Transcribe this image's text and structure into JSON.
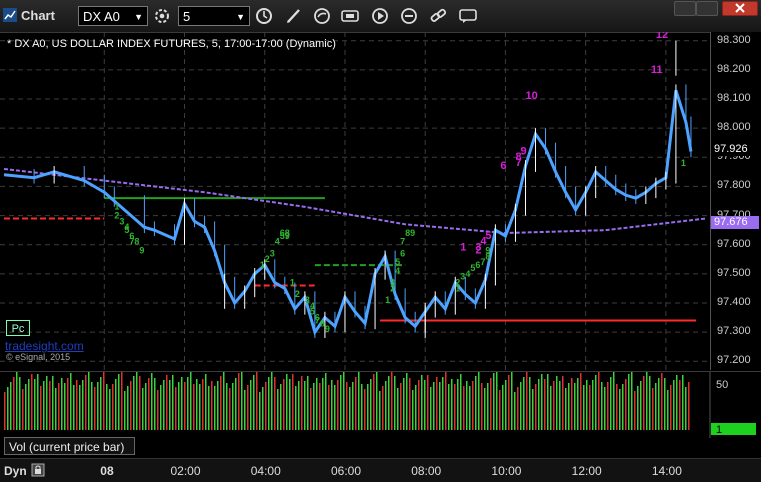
{
  "window": {
    "title": "Chart",
    "symbol": "DX A0",
    "interval": "5"
  },
  "chart_header": "* DX A0, US DOLLAR INDEX FUTURES, 5, 17:00-17:00 (Dynamic)",
  "badge": "Pc",
  "watermark": "tradesight.com",
  "copyright": "© eSignal, 2015",
  "volume_label": "Vol (current price bar)",
  "dyn_label": "Dyn",
  "colors": {
    "up": "#4da3ff",
    "down": "#ffffff",
    "ma": "#9a6cf0",
    "support": "#ff2a2a",
    "resistance": "#1fa21f",
    "seq_magenta": "#d61fd6",
    "seq_green": "#2fb52f",
    "vol_up": "#3cd23c",
    "vol_down": "#e23030"
  },
  "chart_data": {
    "type": "candlestick",
    "y_range": [
      97.17,
      98.33
    ],
    "y_ticks": [
      "98.300",
      "98.200",
      "98.100",
      "98.000",
      "97.900",
      "97.800",
      "97.700",
      "97.600",
      "97.500",
      "97.400",
      "97.300",
      "97.200"
    ],
    "x_ticks": [
      "08",
      "02:00",
      "04:00",
      "06:00",
      "08:00",
      "10:00",
      "12:00",
      "14:00"
    ],
    "current_price": "97.926",
    "ma_value": "97.676",
    "price_path": [
      [
        0,
        97.84
      ],
      [
        6,
        97.83
      ],
      [
        10,
        97.85
      ],
      [
        16,
        97.82
      ],
      [
        20,
        97.78
      ],
      [
        22,
        97.75
      ],
      [
        28,
        97.66
      ],
      [
        30,
        97.65
      ],
      [
        34,
        97.62
      ],
      [
        36,
        97.74
      ],
      [
        38,
        97.68
      ],
      [
        40,
        97.66
      ],
      [
        42,
        97.58
      ],
      [
        44,
        97.47
      ],
      [
        46,
        97.4
      ],
      [
        48,
        97.44
      ],
      [
        50,
        97.5
      ],
      [
        52,
        97.53
      ],
      [
        54,
        97.47
      ],
      [
        56,
        97.45
      ],
      [
        58,
        97.38
      ],
      [
        60,
        97.42
      ],
      [
        62,
        97.3
      ],
      [
        64,
        97.35
      ],
      [
        66,
        97.32
      ],
      [
        68,
        97.42
      ],
      [
        70,
        97.37
      ],
      [
        72,
        97.33
      ],
      [
        74,
        97.5
      ],
      [
        76,
        97.56
      ],
      [
        78,
        97.43
      ],
      [
        80,
        97.35
      ],
      [
        82,
        97.32
      ],
      [
        84,
        97.37
      ],
      [
        86,
        97.42
      ],
      [
        88,
        97.38
      ],
      [
        90,
        97.47
      ],
      [
        92,
        97.43
      ],
      [
        94,
        97.4
      ],
      [
        96,
        97.48
      ],
      [
        98,
        97.65
      ],
      [
        100,
        97.63
      ],
      [
        102,
        97.72
      ],
      [
        104,
        97.87
      ],
      [
        106,
        97.98
      ],
      [
        108,
        97.93
      ],
      [
        110,
        97.85
      ],
      [
        112,
        97.78
      ],
      [
        114,
        97.72
      ],
      [
        116,
        97.78
      ],
      [
        118,
        97.85
      ],
      [
        120,
        97.82
      ],
      [
        122,
        97.79
      ],
      [
        124,
        97.77
      ],
      [
        126,
        97.76
      ],
      [
        128,
        97.78
      ],
      [
        130,
        97.81
      ],
      [
        132,
        97.83
      ],
      [
        134,
        98.13
      ],
      [
        136,
        98.02
      ],
      [
        137,
        97.92
      ]
    ],
    "high_low_marks": [
      [
        84,
        97.28
      ],
      [
        134,
        98.18
      ],
      [
        44,
        97.38
      ]
    ],
    "ma_path": [
      [
        0,
        97.86
      ],
      [
        20,
        97.82
      ],
      [
        40,
        97.78
      ],
      [
        60,
        97.73
      ],
      [
        80,
        97.67
      ],
      [
        100,
        97.64
      ],
      [
        120,
        97.65
      ],
      [
        140,
        97.69
      ]
    ],
    "series": [
      {
        "name": "",
        "kind": "horizontal",
        "from": 0,
        "to": 20,
        "value": 97.69,
        "style": "support-dash"
      },
      {
        "name": "",
        "kind": "horizontal",
        "from": 20,
        "to": 64,
        "value": 97.76,
        "style": "resistance"
      },
      {
        "name": "",
        "kind": "horizontal",
        "from": 50,
        "to": 62,
        "value": 97.46,
        "style": "support-dash"
      },
      {
        "name": "",
        "kind": "horizontal",
        "from": 62,
        "to": 80,
        "value": 97.53,
        "style": "resistance-dash"
      },
      {
        "name": "",
        "kind": "horizontal",
        "from": 75,
        "to": 138,
        "value": 97.34,
        "style": "support"
      }
    ],
    "sequential_counts": [
      {
        "label": "12",
        "x": 130,
        "y": 98.31,
        "color": "magenta"
      },
      {
        "label": "11",
        "x": 129,
        "y": 98.19,
        "color": "magenta"
      },
      {
        "label": "10",
        "x": 104,
        "y": 98.1,
        "color": "magenta"
      },
      {
        "label": "9",
        "x": 103,
        "y": 97.91,
        "color": "magenta"
      },
      {
        "label": "8",
        "x": 102,
        "y": 97.89,
        "color": "magenta"
      },
      {
        "label": "7",
        "x": 102,
        "y": 97.87,
        "color": "magenta"
      },
      {
        "label": "6",
        "x": 99,
        "y": 97.86,
        "color": "magenta"
      },
      {
        "label": "5",
        "x": 96,
        "y": 97.62,
        "color": "magenta"
      },
      {
        "label": "4",
        "x": 95,
        "y": 97.6,
        "color": "magenta"
      },
      {
        "label": "3",
        "x": 94,
        "y": 97.58,
        "color": "magenta"
      },
      {
        "label": "2",
        "x": 94,
        "y": 97.57,
        "color": "magenta"
      },
      {
        "label": "1",
        "x": 91,
        "y": 97.58,
        "color": "magenta"
      },
      {
        "label": "1",
        "x": 135,
        "y": 97.87,
        "color": "green"
      },
      {
        "label": "1",
        "x": 22,
        "y": 97.72,
        "color": "green"
      },
      {
        "label": "2",
        "x": 22,
        "y": 97.69,
        "color": "green"
      },
      {
        "label": "3",
        "x": 23,
        "y": 97.67,
        "color": "green"
      },
      {
        "label": "4",
        "x": 24,
        "y": 97.65,
        "color": "green"
      },
      {
        "label": "5",
        "x": 24,
        "y": 97.64,
        "color": "green"
      },
      {
        "label": "6",
        "x": 25,
        "y": 97.62,
        "color": "green"
      },
      {
        "label": "7",
        "x": 25,
        "y": 97.6,
        "color": "green"
      },
      {
        "label": "8",
        "x": 26,
        "y": 97.6,
        "color": "green"
      },
      {
        "label": "9",
        "x": 27,
        "y": 97.57,
        "color": "green"
      },
      {
        "label": "1",
        "x": 51,
        "y": 97.52,
        "color": "green"
      },
      {
        "label": "2",
        "x": 52,
        "y": 97.54,
        "color": "green"
      },
      {
        "label": "3",
        "x": 53,
        "y": 97.56,
        "color": "green"
      },
      {
        "label": "4",
        "x": 54,
        "y": 97.6,
        "color": "green"
      },
      {
        "label": "5",
        "x": 55,
        "y": 97.62,
        "color": "green"
      },
      {
        "label": "6",
        "x": 55,
        "y": 97.63,
        "color": "green"
      },
      {
        "label": "7",
        "x": 56,
        "y": 97.62,
        "color": "green"
      },
      {
        "label": "8",
        "x": 56,
        "y": 97.63,
        "color": "green"
      },
      {
        "label": "9",
        "x": 56,
        "y": 97.62,
        "color": "green"
      },
      {
        "label": "1",
        "x": 57,
        "y": 97.46,
        "color": "green"
      },
      {
        "label": "2",
        "x": 58,
        "y": 97.42,
        "color": "green"
      },
      {
        "label": "3",
        "x": 60,
        "y": 97.4,
        "color": "green"
      },
      {
        "label": "4",
        "x": 61,
        "y": 97.38,
        "color": "green"
      },
      {
        "label": "5",
        "x": 61,
        "y": 97.36,
        "color": "green"
      },
      {
        "label": "6",
        "x": 62,
        "y": 97.34,
        "color": "green"
      },
      {
        "label": "7",
        "x": 62,
        "y": 97.33,
        "color": "green"
      },
      {
        "label": "8",
        "x": 63,
        "y": 97.32,
        "color": "green"
      },
      {
        "label": "9",
        "x": 64,
        "y": 97.3,
        "color": "green"
      },
      {
        "label": "1",
        "x": 76,
        "y": 97.4,
        "color": "green"
      },
      {
        "label": "2",
        "x": 77,
        "y": 97.44,
        "color": "green"
      },
      {
        "label": "3",
        "x": 77,
        "y": 97.46,
        "color": "green"
      },
      {
        "label": "4",
        "x": 78,
        "y": 97.5,
        "color": "green"
      },
      {
        "label": "5",
        "x": 78,
        "y": 97.53,
        "color": "green"
      },
      {
        "label": "6",
        "x": 79,
        "y": 97.56,
        "color": "green"
      },
      {
        "label": "7",
        "x": 79,
        "y": 97.6,
        "color": "green"
      },
      {
        "label": "8",
        "x": 80,
        "y": 97.63,
        "color": "green"
      },
      {
        "label": "9",
        "x": 81,
        "y": 97.63,
        "color": "green"
      },
      {
        "label": "1",
        "x": 90,
        "y": 97.44,
        "color": "green"
      },
      {
        "label": "2",
        "x": 90,
        "y": 97.46,
        "color": "green"
      },
      {
        "label": "3",
        "x": 91,
        "y": 97.48,
        "color": "green"
      },
      {
        "label": "4",
        "x": 92,
        "y": 97.49,
        "color": "green"
      },
      {
        "label": "5",
        "x": 93,
        "y": 97.51,
        "color": "green"
      },
      {
        "label": "6",
        "x": 94,
        "y": 97.52,
        "color": "green"
      },
      {
        "label": "7",
        "x": 95,
        "y": 97.53,
        "color": "green"
      },
      {
        "label": "8",
        "x": 96,
        "y": 97.55,
        "color": "green"
      },
      {
        "label": "9",
        "x": 96,
        "y": 97.57,
        "color": "green"
      }
    ],
    "volume_axis": {
      "ticks": [
        "50"
      ],
      "current": "1"
    }
  }
}
